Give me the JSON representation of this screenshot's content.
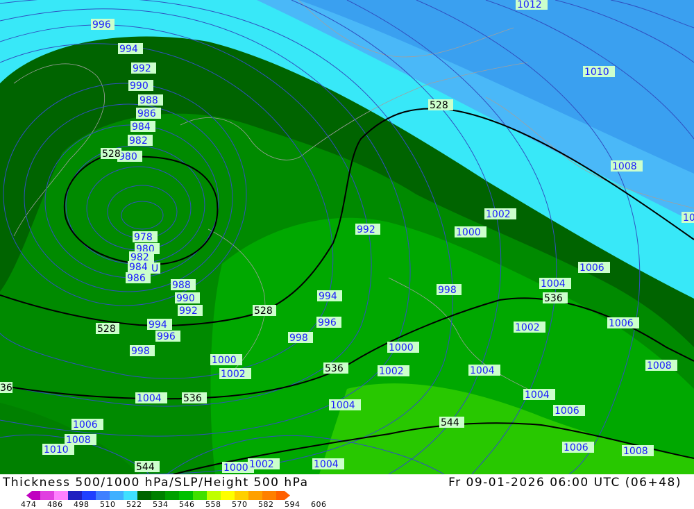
{
  "footer": {
    "title": "Thickness 500/1000 hPa/SLP/Height 500 hPa",
    "datetime": "Fr 09-01-2026 06:00 UTC (06+48)"
  },
  "colors": {
    "thickness_scale": [
      "#c000c0",
      "#e040e0",
      "#ff80ff",
      "#2020c0",
      "#2040ff",
      "#4080ff",
      "#40b0ff",
      "#40e0ff",
      "#006400",
      "#008000",
      "#00a000",
      "#00c000",
      "#40e000",
      "#c0ff00",
      "#ffff00",
      "#ffd000",
      "#ffa000",
      "#ff8000",
      "#ff6000"
    ],
    "slp_isobar": "#3050c0",
    "height_contour": "#000000",
    "label_box": "#ccffcc"
  },
  "scale": {
    "ticks": [
      "474",
      "486",
      "498",
      "510",
      "522",
      "534",
      "546",
      "558",
      "570",
      "582",
      "594",
      "606"
    ]
  },
  "map": {
    "slp_labels": [
      "996",
      "994",
      "992",
      "990",
      "988",
      "986",
      "984",
      "982",
      "980",
      "978",
      "980",
      "982",
      "984",
      "986",
      "988",
      "990",
      "992",
      "994",
      "996",
      "998",
      "1000",
      "1002",
      "1004",
      "1006",
      "1008",
      "1010",
      "1012",
      "1010",
      "1008",
      "1002",
      "1000",
      "992",
      "994",
      "996",
      "998",
      "1000",
      "1002",
      "1004",
      "1006",
      "1004",
      "1002",
      "1004",
      "1006",
      "1008",
      "998",
      "1000",
      "1002",
      "1004",
      "1004",
      "1006",
      "1006",
      "1008",
      "1006",
      "1004",
      "1000",
      "1008",
      "10"
    ],
    "height_labels": [
      "528",
      "528",
      "528",
      "528",
      "536",
      "536",
      "536",
      "536",
      "544",
      "544",
      "36"
    ],
    "low_marker": "U"
  }
}
